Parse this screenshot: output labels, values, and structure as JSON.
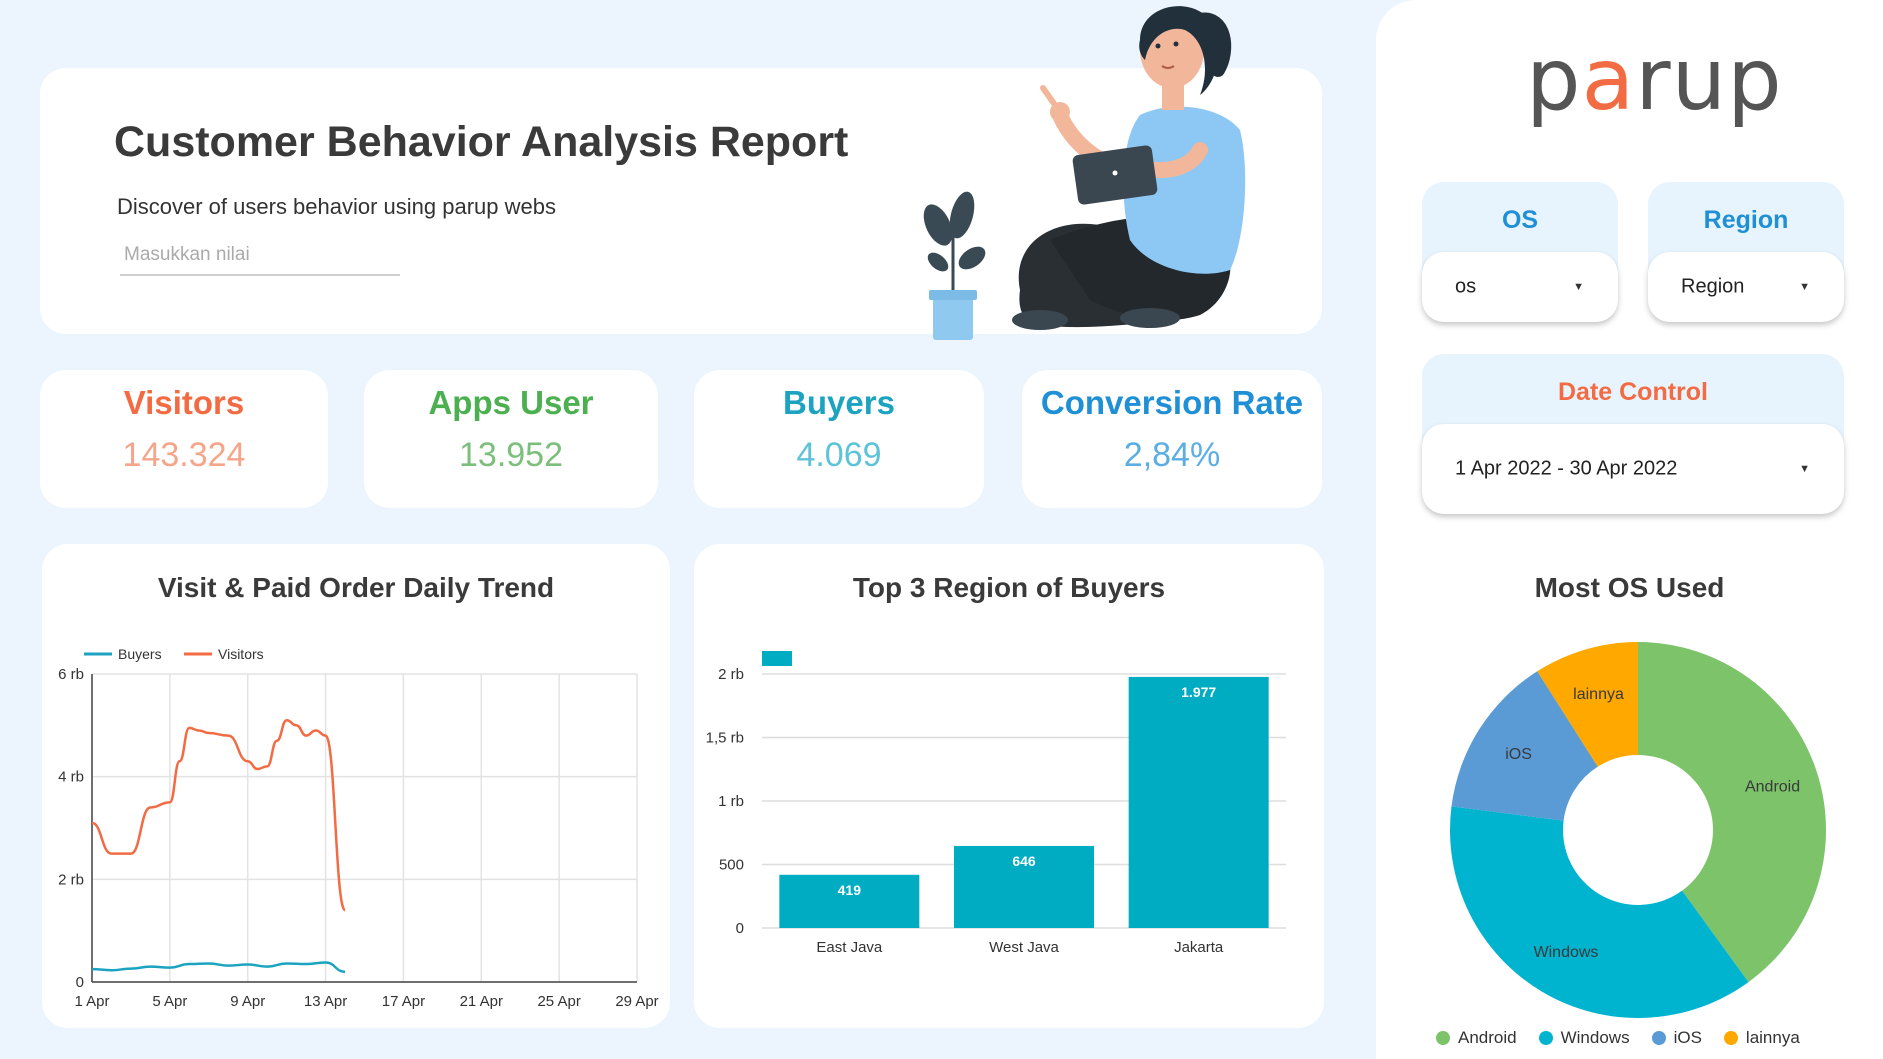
{
  "header": {
    "title": "Customer Behavior Analysis Report",
    "subtitle": "Discover of users behavior using parup webs",
    "search_placeholder": "Masukkan nilai"
  },
  "kpis": [
    {
      "label": "Visitors",
      "value": "143.324",
      "label_color": "#f26b43",
      "value_color": "#f5a58a"
    },
    {
      "label": "Apps User",
      "value": "13.952",
      "label_color": "#4caf50",
      "value_color": "#7cbf7c"
    },
    {
      "label": "Buyers",
      "value": "4.069",
      "label_color": "#1ba3c0",
      "value_color": "#5dc3d8"
    },
    {
      "label": "Conversion Rate",
      "value": "2,84%",
      "label_color": "#1f8fd6",
      "value_color": "#5aaee3"
    }
  ],
  "sidebar": {
    "logo_parts": [
      "p",
      "a",
      "rup"
    ],
    "os_filter": {
      "label": "OS",
      "value": "os"
    },
    "region_filter": {
      "label": "Region",
      "value": "Region"
    },
    "date_control": {
      "label": "Date Control",
      "value": "1 Apr 2022 - 30 Apr 2022"
    },
    "os_chart_title": "Most OS Used"
  },
  "chart_data": [
    {
      "type": "line",
      "title": "Visit & Paid Order Daily Trend",
      "x_ticks": [
        "1 Apr",
        "5 Apr",
        "9 Apr",
        "13 Apr",
        "17 Apr",
        "21 Apr",
        "25 Apr",
        "29 Apr"
      ],
      "y_ticks": [
        "0",
        "2 rb",
        "4 rb",
        "6 rb"
      ],
      "ylim": [
        0,
        6000
      ],
      "xlim": [
        1,
        29
      ],
      "grid": true,
      "legend": "top-left",
      "series": [
        {
          "name": "Buyers",
          "color": "#1ba3c0",
          "x": [
            1,
            2,
            3,
            4,
            5,
            6,
            7,
            8,
            9,
            10,
            11,
            12,
            13,
            14
          ],
          "values": [
            250,
            230,
            260,
            300,
            280,
            350,
            360,
            320,
            340,
            300,
            360,
            350,
            380,
            200
          ]
        },
        {
          "name": "Visitors",
          "color": "#f26b43",
          "x": [
            1,
            2,
            3,
            4,
            5,
            5.5,
            6,
            6.5,
            7,
            8,
            9,
            9.5,
            10,
            10.5,
            11,
            11.5,
            12,
            12.5,
            13,
            14
          ],
          "values": [
            3100,
            2500,
            2500,
            3400,
            3500,
            4300,
            4950,
            4900,
            4850,
            4800,
            4300,
            4150,
            4200,
            4700,
            5100,
            5000,
            4800,
            4900,
            4800,
            1400
          ]
        }
      ]
    },
    {
      "type": "bar",
      "title": "Top 3 Region of Buyers",
      "categories": [
        "East Java",
        "West Java",
        "Jakarta"
      ],
      "values": [
        419,
        646,
        1977
      ],
      "value_labels": [
        "419",
        "646",
        "1.977"
      ],
      "y_ticks": [
        "0",
        "500",
        "1 rb",
        "1,5 rb",
        "2 rb"
      ],
      "ylim": [
        0,
        2000
      ],
      "color": "#00acc1",
      "grid": true
    },
    {
      "type": "pie",
      "title": "Most OS Used",
      "categories": [
        "Android",
        "Windows",
        "iOS",
        "lainnya"
      ],
      "values": [
        40,
        37,
        14,
        9
      ],
      "colors": [
        "#7cc36a",
        "#00b4d0",
        "#5a9bd5",
        "#ffa800"
      ],
      "donut": true,
      "legend": "bottom"
    }
  ]
}
